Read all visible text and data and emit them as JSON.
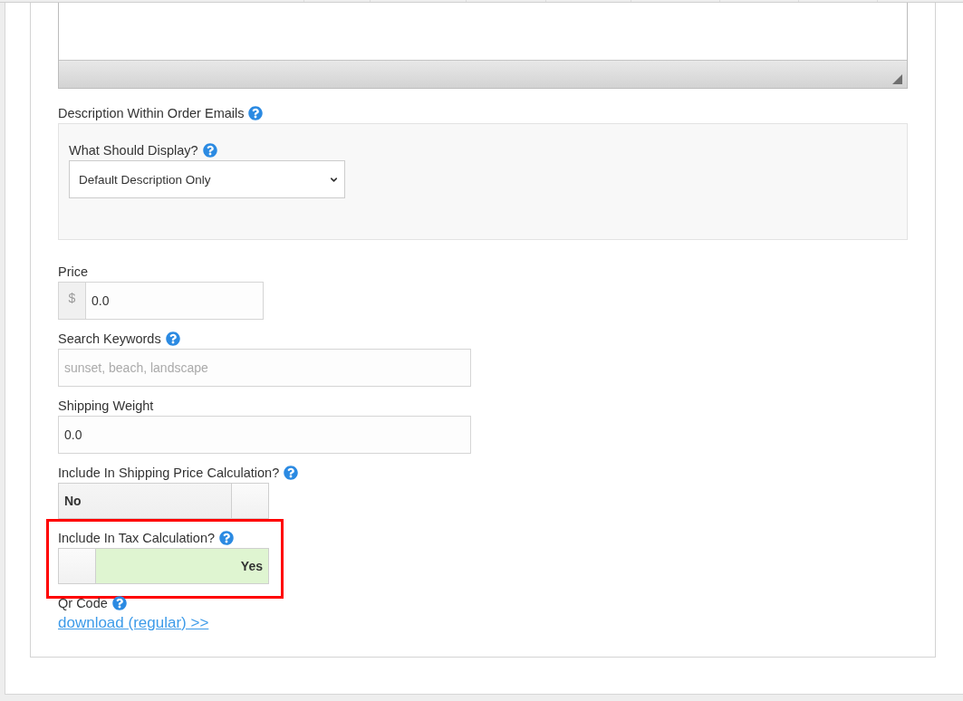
{
  "order_email_description": {
    "label": "Description Within Order Emails",
    "help": true,
    "display": {
      "label": "What Should Display?",
      "help": true,
      "value": "Default Description Only"
    }
  },
  "fields": [
    {
      "kind": "currency",
      "label": "Price",
      "help": false,
      "prefix": "$",
      "value": "0.0",
      "highlighted": false
    },
    {
      "kind": "text",
      "label": "Search Keywords",
      "help": true,
      "placeholder": "sunset, beach, landscape",
      "highlighted": false
    },
    {
      "kind": "text",
      "label": "Shipping Weight",
      "help": false,
      "value": "0.0",
      "highlighted": false
    },
    {
      "kind": "toggle",
      "label": "Include In Shipping Price Calculation?",
      "help": true,
      "on": false,
      "state_text": "No",
      "highlighted": false
    },
    {
      "kind": "toggle",
      "label": "Include In Tax Calculation?",
      "help": true,
      "on": true,
      "state_text": "Yes",
      "highlighted": true
    },
    {
      "kind": "link",
      "label": "Qr Code",
      "help": true,
      "link": "download (regular) >>",
      "highlighted": false
    }
  ]
}
